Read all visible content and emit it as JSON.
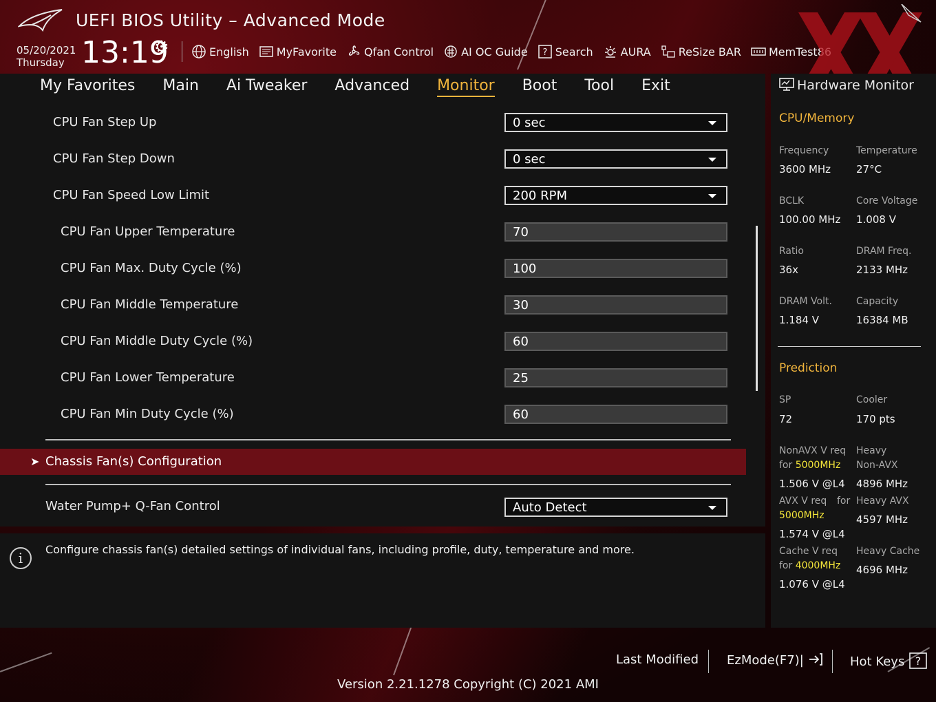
{
  "header": {
    "title": "UEFI BIOS Utility – Advanced Mode",
    "date": "05/20/2021",
    "day": "Thursday",
    "time": "13:19"
  },
  "toolbar": [
    {
      "label": "English",
      "icon": "globe-icon"
    },
    {
      "label": "MyFavorite",
      "icon": "favorite-icon"
    },
    {
      "label": "Qfan Control",
      "icon": "fan-icon"
    },
    {
      "label": "AI OC Guide",
      "icon": "ai-oc-icon"
    },
    {
      "label": "Search",
      "icon": "search-icon"
    },
    {
      "label": "AURA",
      "icon": "aura-icon"
    },
    {
      "label": "ReSize BAR",
      "icon": "resize-bar-icon"
    },
    {
      "label": "MemTest86",
      "icon": "memtest-icon"
    }
  ],
  "tabs": [
    {
      "label": "My Favorites",
      "active": false
    },
    {
      "label": "Main",
      "active": false
    },
    {
      "label": "Ai Tweaker",
      "active": false
    },
    {
      "label": "Advanced",
      "active": false
    },
    {
      "label": "Monitor",
      "active": true
    },
    {
      "label": "Boot",
      "active": false
    },
    {
      "label": "Tool",
      "active": false
    },
    {
      "label": "Exit",
      "active": false
    }
  ],
  "settings": [
    {
      "label": "CPU Fan Step Up",
      "value": "0 sec",
      "type": "select"
    },
    {
      "label": "CPU Fan Step Down",
      "value": "0 sec",
      "type": "select"
    },
    {
      "label": "CPU Fan Speed Low Limit",
      "value": "200 RPM",
      "type": "select"
    },
    {
      "label": "CPU Fan Upper Temperature",
      "value": "70",
      "type": "text"
    },
    {
      "label": "CPU Fan Max. Duty Cycle (%)",
      "value": "100",
      "type": "text"
    },
    {
      "label": "CPU Fan Middle Temperature",
      "value": "30",
      "type": "text"
    },
    {
      "label": "CPU Fan Middle Duty Cycle (%)",
      "value": "60",
      "type": "text"
    },
    {
      "label": "CPU Fan Lower Temperature",
      "value": "25",
      "type": "text"
    },
    {
      "label": "CPU Fan Min Duty Cycle (%)",
      "value": "60",
      "type": "text"
    }
  ],
  "submenu": {
    "label": "Chassis Fan(s) Configuration"
  },
  "water_pump": {
    "label": "Water Pump+ Q-Fan Control",
    "value": "Auto Detect"
  },
  "info": {
    "text": "Configure chassis fan(s) detailed settings of individual fans, including profile, duty, temperature and more."
  },
  "hw_monitor": {
    "title": "Hardware Monitor",
    "cpu_memory": {
      "heading": "CPU/Memory",
      "items": [
        {
          "label": "Frequency",
          "value": "3600 MHz"
        },
        {
          "label": "Temperature",
          "value": "27°C"
        },
        {
          "label": "BCLK",
          "value": "100.00 MHz"
        },
        {
          "label": "Core Voltage",
          "value": "1.008 V"
        },
        {
          "label": "Ratio",
          "value": "36x"
        },
        {
          "label": "DRAM Freq.",
          "value": "2133 MHz"
        },
        {
          "label": "DRAM Volt.",
          "value": "1.184 V"
        },
        {
          "label": "Capacity",
          "value": "16384 MB"
        }
      ]
    },
    "prediction": {
      "heading": "Prediction",
      "sp_label": "SP",
      "sp_value": "72",
      "cooler_label": "Cooler",
      "cooler_value": "170 pts",
      "nonavx_label": "NonAVX V req",
      "nonavx_for": "for",
      "nonavx_freq": "5000MHz",
      "nonavx_value": "1.506 V @L4",
      "heavy_nonavx_label1": "Heavy",
      "heavy_nonavx_label2": "Non-AVX",
      "heavy_nonavx_value": "4896 MHz",
      "avx_label": "AVX V req",
      "avx_for": "for",
      "avx_freq": "5000MHz",
      "avx_value": "1.574 V @L4",
      "heavy_avx_label": "Heavy AVX",
      "heavy_avx_value": "4597 MHz",
      "cache_label": "Cache V req",
      "cache_for": "for",
      "cache_freq": "4000MHz",
      "cache_value": "1.076 V @L4",
      "heavy_cache_label": "Heavy Cache",
      "heavy_cache_value": "4696 MHz"
    }
  },
  "footer": {
    "last_modified": "Last Modified",
    "ezmode": "EzMode(F7)|",
    "hotkeys": "Hot Keys",
    "version": "Version 2.21.1278 Copyright (C) 2021 AMI"
  },
  "colors": {
    "accent": "#f0b43c",
    "highlight_row": "#6b0f16",
    "frequency_highlight": "#f5e63a"
  }
}
